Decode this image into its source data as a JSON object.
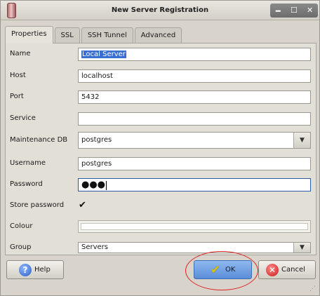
{
  "window": {
    "title": "New Server Registration",
    "controls": [
      "🗕",
      "☐",
      "✕"
    ]
  },
  "tabs": [
    {
      "label": "Properties",
      "active": true
    },
    {
      "label": "SSL",
      "active": false
    },
    {
      "label": "SSH Tunnel",
      "active": false
    },
    {
      "label": "Advanced",
      "active": false
    }
  ],
  "form": {
    "name": {
      "label": "Name",
      "value": "Local Server"
    },
    "host": {
      "label": "Host",
      "value": "localhost"
    },
    "port": {
      "label": "Port",
      "value": "5432"
    },
    "service": {
      "label": "Service",
      "value": ""
    },
    "maintenance_db": {
      "label": "Maintenance DB",
      "value": "postgres"
    },
    "username": {
      "label": "Username",
      "value": "postgres"
    },
    "password": {
      "label": "Password",
      "value": "●●●"
    },
    "store_password": {
      "label": "Store password",
      "checked": true,
      "mark": "✔"
    },
    "colour": {
      "label": "Colour"
    },
    "group": {
      "label": "Group",
      "value": "Servers"
    }
  },
  "buttons": {
    "help": "Help",
    "ok": "OK",
    "cancel": "Cancel"
  },
  "icons": {
    "help": "?",
    "ok": "✔",
    "cancel": "✕",
    "dropdown": "▼",
    "grip": "⋰"
  }
}
